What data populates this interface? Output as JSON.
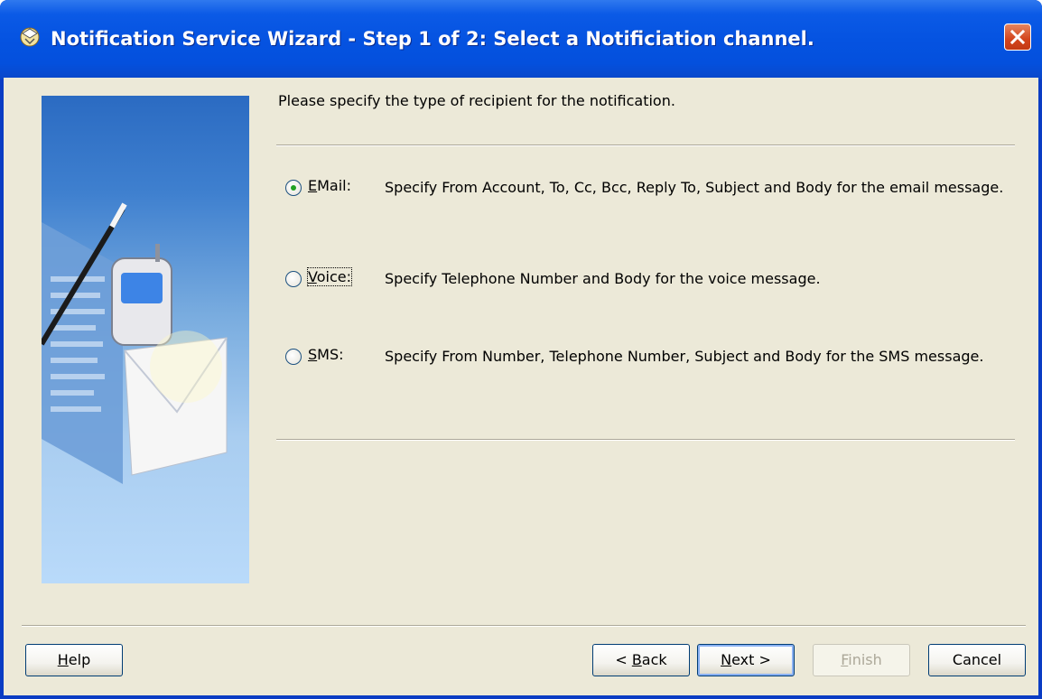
{
  "window": {
    "title": "Notification Service Wizard - Step 1 of 2: Select a Notificiation channel."
  },
  "content": {
    "instruction": "Please specify the type of recipient for the notification.",
    "options": [
      {
        "label": "EMail:",
        "mnemonic": "E",
        "rest": "Mail:",
        "description": "Specify From Account, To, Cc, Bcc, Reply To, Subject and Body for the email message.",
        "selected": true
      },
      {
        "label": "Voice:",
        "mnemonic": "V",
        "rest": "oice:",
        "description": "Specify Telephone Number and Body for the voice message.",
        "selected": false
      },
      {
        "label": "SMS:",
        "mnemonic": "S",
        "rest": "MS:",
        "description": "Specify  From Number, Telephone Number, Subject and Body for the SMS message.",
        "selected": false
      }
    ]
  },
  "buttons": {
    "help": {
      "mnemonic": "H",
      "rest": "elp"
    },
    "back": {
      "prefix": "< ",
      "mnemonic": "B",
      "rest": "ack"
    },
    "next": {
      "mnemonic": "N",
      "rest": "ext >"
    },
    "finish": {
      "mnemonic": "F",
      "rest": "inish",
      "disabled": true
    },
    "cancel": {
      "label": "Cancel"
    }
  },
  "icons": {
    "title": "wizard-app-icon",
    "close": "close-icon",
    "illustration": "notification-illustration"
  },
  "colors": {
    "titlebar": "#0553e1",
    "client": "#ece9d8",
    "close": "#d3441c",
    "radio_dot": "#21a121"
  }
}
